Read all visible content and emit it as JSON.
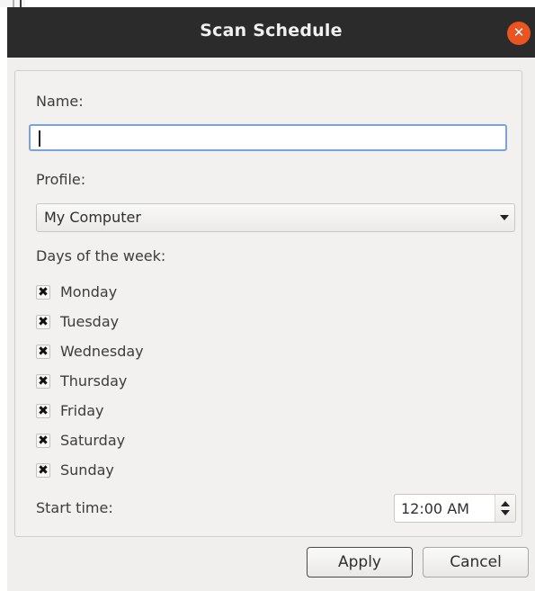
{
  "dialog": {
    "title": "Scan Schedule",
    "close_icon": "close-icon"
  },
  "form": {
    "name_label": "Name:",
    "name_value": "",
    "profile_label": "Profile:",
    "profile_selected": "My Computer",
    "days_label": "Days of the week:",
    "days": [
      {
        "label": "Monday",
        "checked": true
      },
      {
        "label": "Tuesday",
        "checked": true
      },
      {
        "label": "Wednesday",
        "checked": true
      },
      {
        "label": "Thursday",
        "checked": true
      },
      {
        "label": "Friday",
        "checked": true
      },
      {
        "label": "Saturday",
        "checked": true
      },
      {
        "label": "Sunday",
        "checked": true
      }
    ],
    "check_mark": "✖",
    "start_time_label": "Start time:",
    "start_time_value": "12:00 AM"
  },
  "buttons": {
    "apply": "Apply",
    "cancel": "Cancel"
  },
  "colors": {
    "titlebar": "#2b2b2b",
    "close_button": "#e95420",
    "focus_border": "#7aa3d8"
  }
}
